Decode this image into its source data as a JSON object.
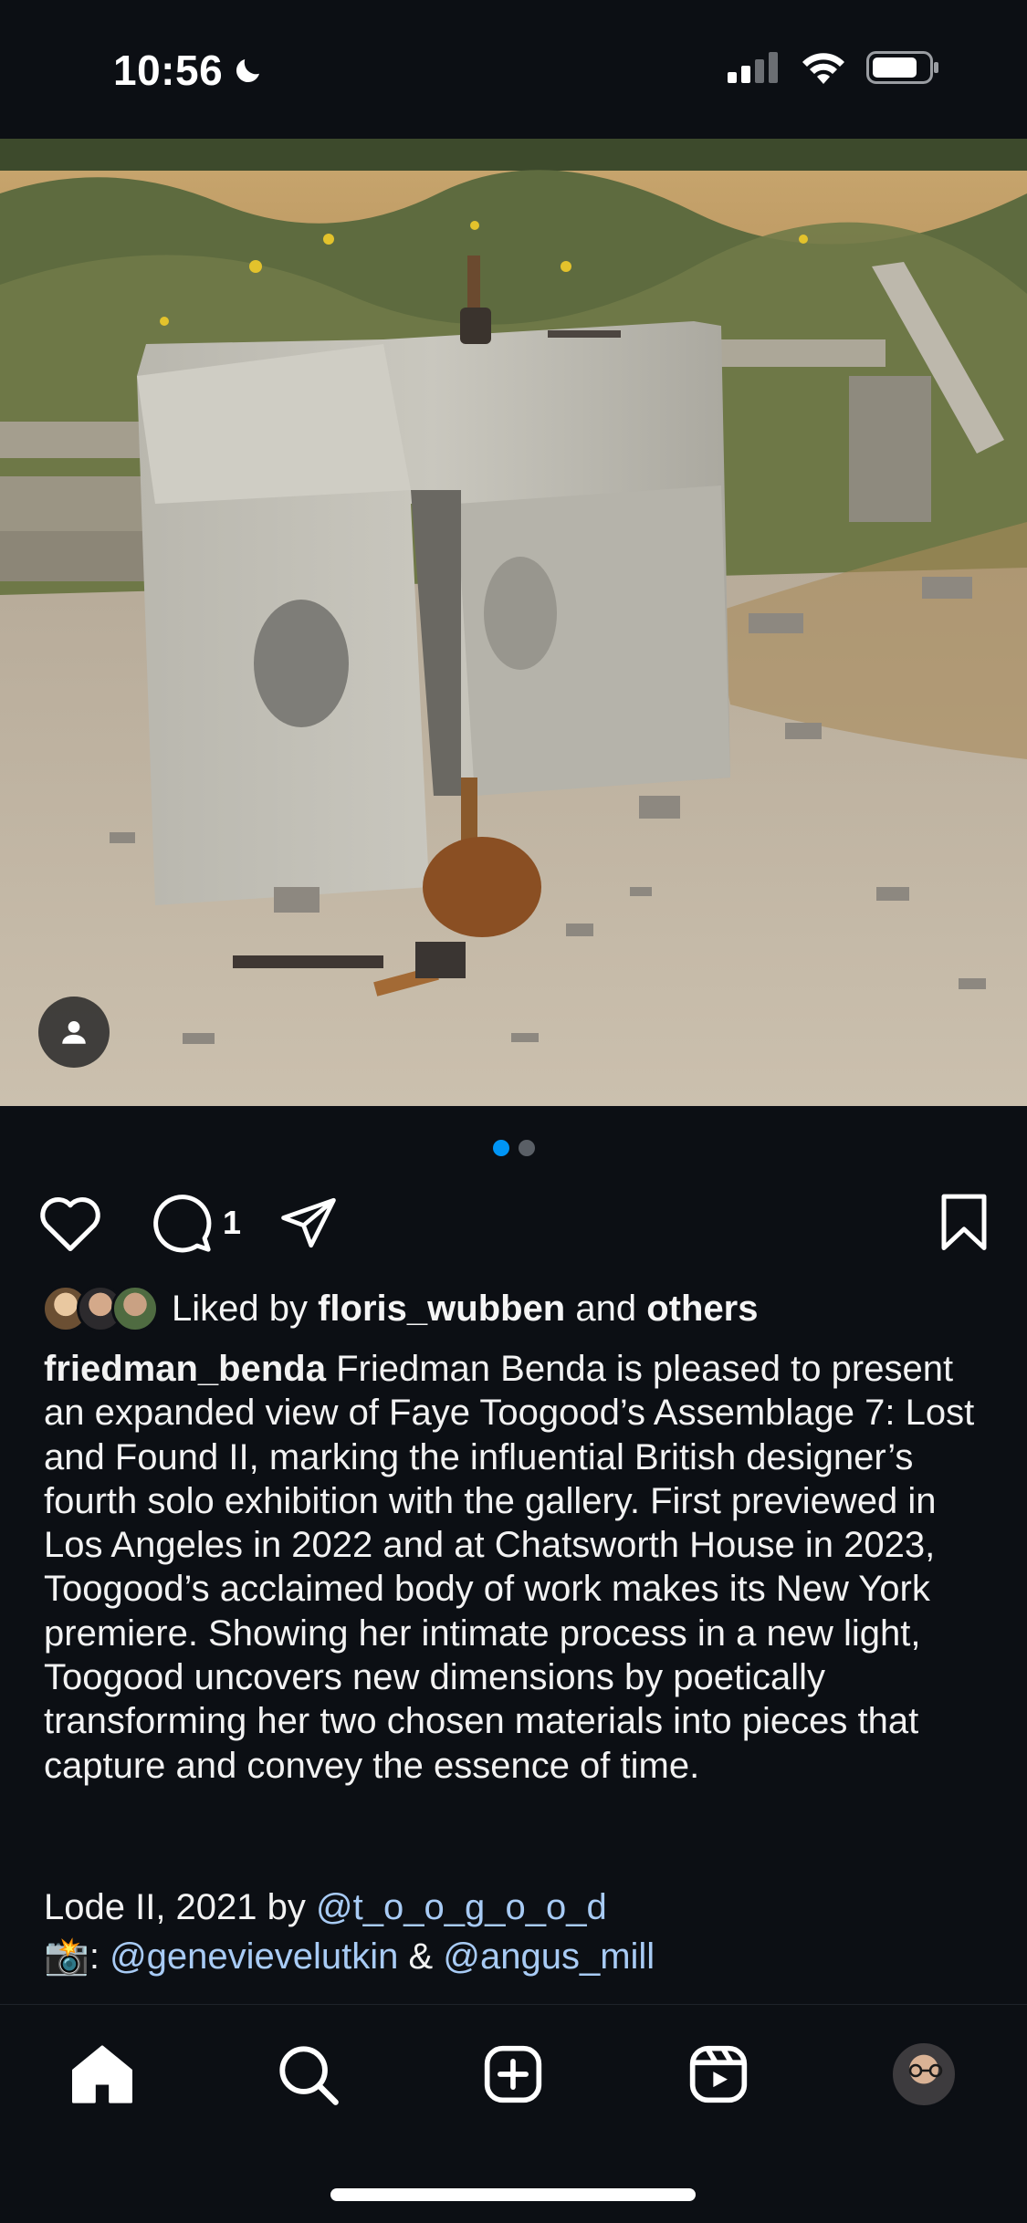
{
  "status_bar": {
    "time": "10:56",
    "icons": [
      "moon-icon",
      "cellular-signal-icon",
      "wifi-icon",
      "battery-icon"
    ]
  },
  "post": {
    "image_description_icons": [
      "tagged-people-icon"
    ],
    "carousel": {
      "total": 2,
      "current": 1
    },
    "comment_count": "1",
    "liked_by": {
      "prefix": "Liked by",
      "user": "floris_wubben",
      "conjunction": "and",
      "others": "others"
    },
    "caption": {
      "username": "friedman_benda",
      "text": "Friedman Benda is pleased to present an expanded view of Faye Toogood’s Assemblage 7: Lost and Found II, marking the influential British designer’s fourth solo exhibition with the gallery. First previewed in Los Angeles in 2022 and at Chatsworth House in 2023, Toogood’s acclaimed body of work makes its New York premiere. Showing her intimate process in a new light, Toogood uncovers new dimensions by poetically transforming her two chosen materials into pieces that capture and convey the essence of time."
    },
    "credits": {
      "line1_prefix": "Lode II, 2021 by",
      "line1_mention": "@t_o_o_g_o_o_d",
      "line2_emoji": "📸",
      "line2_sep": ":",
      "line2_mention1": "@genevievelutkin",
      "line2_amp": "&",
      "line2_mention2": "@angus_mill"
    }
  },
  "nav": [
    "home-icon",
    "search-icon",
    "create-icon",
    "reels-icon",
    "profile-avatar"
  ],
  "colors": {
    "background": "#0c0f14",
    "accent": "#0095f6",
    "mention": "#a8cbf5"
  }
}
